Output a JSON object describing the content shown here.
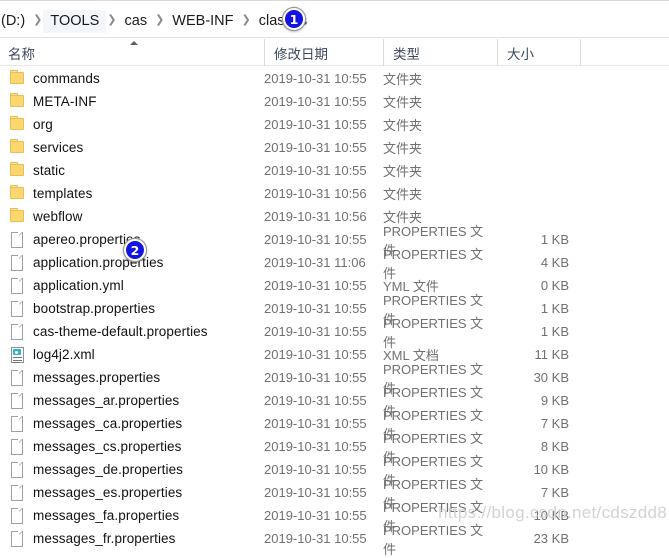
{
  "window": {
    "type": "file-explorer",
    "accent_color": "#1414e0",
    "folder_icon_color": "#fcd770"
  },
  "breadcrumb": {
    "separator": "❯",
    "items": [
      {
        "label": "(D:)",
        "highlighted": false
      },
      {
        "label": "TOOLS",
        "highlighted": true
      },
      {
        "label": "cas",
        "highlighted": false
      },
      {
        "label": "WEB-INF",
        "highlighted": false
      },
      {
        "label": "classes",
        "highlighted": false
      }
    ]
  },
  "columns": {
    "name": "名称",
    "date_modified": "修改日期",
    "type": "类型",
    "size": "大小",
    "sort_column": "名称",
    "sort_direction": "ascending"
  },
  "files": [
    {
      "name": "commands",
      "date": "2019-10-31 10:55",
      "type": "文件夹",
      "size": "",
      "icon": "folder-icon"
    },
    {
      "name": "META-INF",
      "date": "2019-10-31 10:55",
      "type": "文件夹",
      "size": "",
      "icon": "folder-icon"
    },
    {
      "name": "org",
      "date": "2019-10-31 10:55",
      "type": "文件夹",
      "size": "",
      "icon": "folder-icon"
    },
    {
      "name": "services",
      "date": "2019-10-31 10:55",
      "type": "文件夹",
      "size": "",
      "icon": "folder-icon"
    },
    {
      "name": "static",
      "date": "2019-10-31 10:55",
      "type": "文件夹",
      "size": "",
      "icon": "folder-icon"
    },
    {
      "name": "templates",
      "date": "2019-10-31 10:56",
      "type": "文件夹",
      "size": "",
      "icon": "folder-icon"
    },
    {
      "name": "webflow",
      "date": "2019-10-31 10:56",
      "type": "文件夹",
      "size": "",
      "icon": "folder-icon"
    },
    {
      "name": "apereo.properties",
      "date": "2019-10-31 10:55",
      "type": "PROPERTIES 文件",
      "size": "1 KB",
      "icon": "file-icon"
    },
    {
      "name": "application.properties",
      "date": "2019-10-31 11:06",
      "type": "PROPERTIES 文件",
      "size": "4 KB",
      "icon": "file-icon"
    },
    {
      "name": "application.yml",
      "date": "2019-10-31 10:55",
      "type": "YML 文件",
      "size": "0 KB",
      "icon": "file-icon"
    },
    {
      "name": "bootstrap.properties",
      "date": "2019-10-31 10:55",
      "type": "PROPERTIES 文件",
      "size": "1 KB",
      "icon": "file-icon"
    },
    {
      "name": "cas-theme-default.properties",
      "date": "2019-10-31 10:55",
      "type": "PROPERTIES 文件",
      "size": "1 KB",
      "icon": "file-icon"
    },
    {
      "name": "log4j2.xml",
      "date": "2019-10-31 10:55",
      "type": "XML 文档",
      "size": "11 KB",
      "icon": "xml-document-icon"
    },
    {
      "name": "messages.properties",
      "date": "2019-10-31 10:55",
      "type": "PROPERTIES 文件",
      "size": "30 KB",
      "icon": "file-icon"
    },
    {
      "name": "messages_ar.properties",
      "date": "2019-10-31 10:55",
      "type": "PROPERTIES 文件",
      "size": "9 KB",
      "icon": "file-icon"
    },
    {
      "name": "messages_ca.properties",
      "date": "2019-10-31 10:55",
      "type": "PROPERTIES 文件",
      "size": "7 KB",
      "icon": "file-icon"
    },
    {
      "name": "messages_cs.properties",
      "date": "2019-10-31 10:55",
      "type": "PROPERTIES 文件",
      "size": "8 KB",
      "icon": "file-icon"
    },
    {
      "name": "messages_de.properties",
      "date": "2019-10-31 10:55",
      "type": "PROPERTIES 文件",
      "size": "10 KB",
      "icon": "file-icon"
    },
    {
      "name": "messages_es.properties",
      "date": "2019-10-31 10:55",
      "type": "PROPERTIES 文件",
      "size": "7 KB",
      "icon": "file-icon"
    },
    {
      "name": "messages_fa.properties",
      "date": "2019-10-31 10:55",
      "type": "PROPERTIES 文件",
      "size": "10 KB",
      "icon": "file-icon"
    },
    {
      "name": "messages_fr.properties",
      "date": "2019-10-31 10:55",
      "type": "PROPERTIES 文件",
      "size": "23 KB",
      "icon": "file-icon"
    }
  ],
  "callouts": [
    {
      "number": "1"
    },
    {
      "number": "2"
    }
  ],
  "watermark": {
    "text": "https://blog.csdn.net/cdszdd8"
  }
}
